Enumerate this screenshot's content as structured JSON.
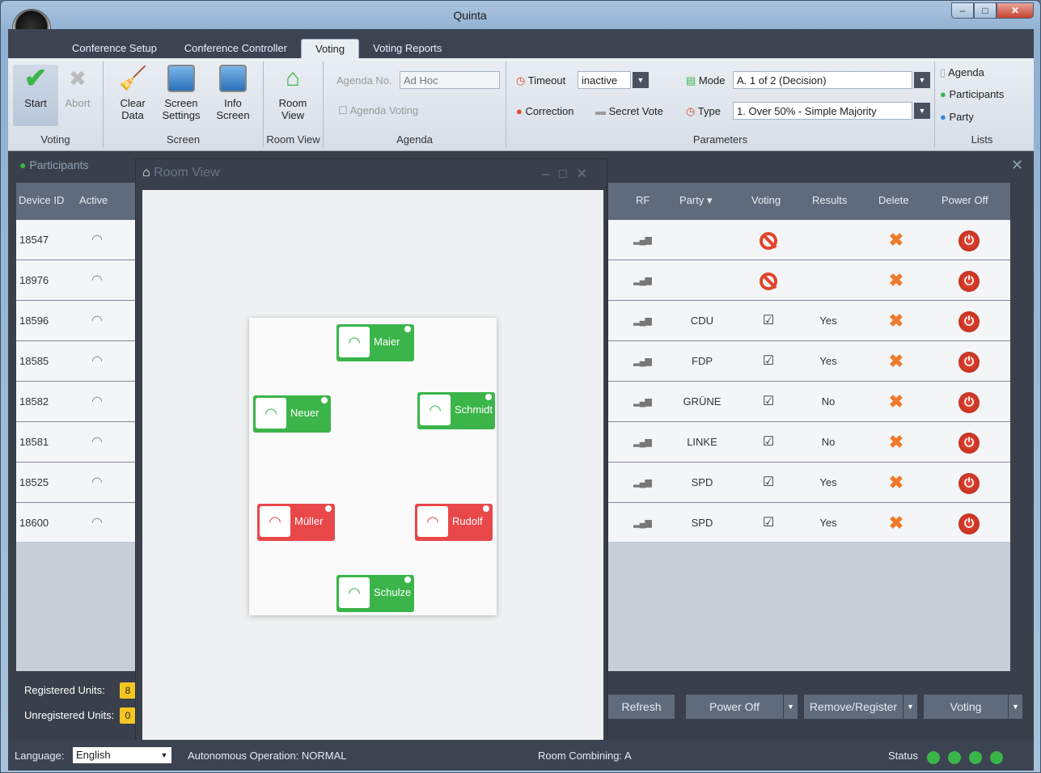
{
  "window": {
    "title": "Quinta"
  },
  "tabs": [
    "Conference Setup",
    "Conference Controller",
    "Voting",
    "Voting Reports"
  ],
  "ribbon": {
    "voting": {
      "label": "Voting",
      "start": "Start",
      "abort": "Abort"
    },
    "screen": {
      "label": "Screen",
      "clear": [
        "Clear",
        "Data"
      ],
      "screen_settings": [
        "Screen",
        "Settings"
      ],
      "info": [
        "Info",
        "Screen"
      ]
    },
    "roomview": {
      "label": "Room View",
      "btn": [
        "Room",
        "View"
      ]
    },
    "agenda": {
      "label": "Agenda",
      "no_label": "Agenda No.",
      "no_value": "Ad Hoc",
      "voting": "Agenda Voting"
    },
    "parameters": {
      "label": "Parameters",
      "timeout_label": "Timeout",
      "timeout_value": "inactive",
      "correction": "Correction",
      "secret": "Secret Vote",
      "mode_label": "Mode",
      "mode_value": "A. 1 of 2 (Decision)",
      "type_label": "Type",
      "type_value": "1. Over 50% - Simple Majority"
    },
    "lists": {
      "label": "Lists",
      "agenda": "Agenda",
      "participants": "Participants",
      "party": "Party"
    }
  },
  "participants_panel": {
    "title": "Participants",
    "headers": {
      "device": "Device ID",
      "active": "Active",
      "rf": "RF",
      "party": "Party",
      "voting": "Voting",
      "results": "Results",
      "delete": "Delete",
      "power": "Power Off"
    },
    "rows": [
      {
        "id": "18547",
        "party": "",
        "voting": "blocked",
        "result": ""
      },
      {
        "id": "18976",
        "party": "",
        "voting": "blocked",
        "result": ""
      },
      {
        "id": "18596",
        "party": "CDU",
        "voting": "checked",
        "result": "Yes"
      },
      {
        "id": "18585",
        "party": "FDP",
        "voting": "checked",
        "result": "Yes"
      },
      {
        "id": "18582",
        "party": "GRÜNE",
        "voting": "checked",
        "result": "No"
      },
      {
        "id": "18581",
        "party": "LINKE",
        "voting": "checked",
        "result": "No"
      },
      {
        "id": "18525",
        "party": "SPD",
        "voting": "checked",
        "result": "Yes"
      },
      {
        "id": "18600",
        "party": "SPD",
        "voting": "checked",
        "result": "Yes"
      }
    ],
    "registered_label": "Registered Units:",
    "registered_value": "8",
    "unregistered_label": "Unregistered Units:",
    "unregistered_value": "0"
  },
  "room_view": {
    "title": "Room View",
    "seats": [
      {
        "name": "Maier",
        "status": "green"
      },
      {
        "name": "Neuer",
        "status": "green"
      },
      {
        "name": "Schmidt",
        "status": "green"
      },
      {
        "name": "Müller",
        "status": "red"
      },
      {
        "name": "Rudolf",
        "status": "red"
      },
      {
        "name": "Schulze",
        "status": "green"
      }
    ]
  },
  "bottom_buttons": {
    "refresh": "Refresh",
    "power_off": "Power Off",
    "remove_register": "Remove/Register",
    "voting": "Voting"
  },
  "statusbar": {
    "language_label": "Language:",
    "language_value": "English",
    "autonomous": "Autonomous Operation:  NORMAL",
    "room_combining": "Room Combining: A",
    "status_label": "Status"
  },
  "colors": {
    "accent_green": "#3bb54a",
    "alert_red": "#e9484a",
    "badge": "#f3c623"
  }
}
